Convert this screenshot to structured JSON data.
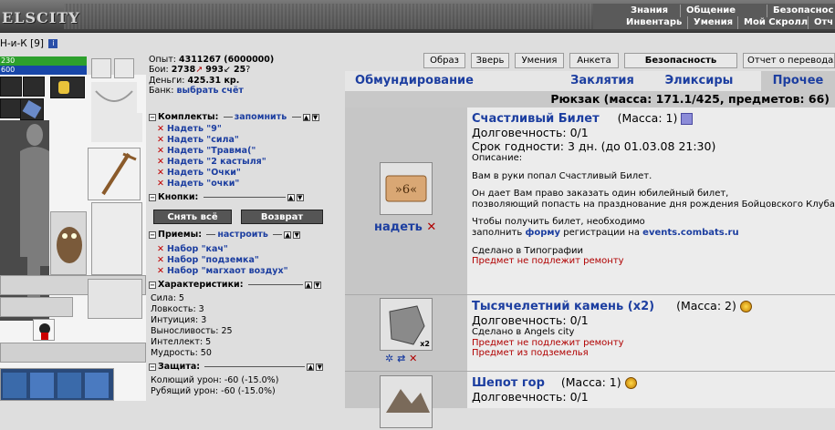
{
  "header": {
    "logo": "ELSCITY",
    "menu_row1": [
      "Знания",
      "Общение",
      "Безопаснос"
    ],
    "menu_row2": [
      "Инвентарь",
      "Умения",
      "Мой Скролл",
      "Отч"
    ]
  },
  "character": {
    "nick": "Н-и-К",
    "level": "[9]",
    "hp": "230",
    "mp": "600"
  },
  "stats": {
    "exp_label": "Опыт:",
    "exp": "4311267",
    "exp_next": "(6000000)",
    "fights_label": "Бои:",
    "wins": "2738",
    "losses": "993",
    "draws": "25",
    "money_label": "Деньги:",
    "money": "425.31 кр.",
    "bank_label": "Банк:",
    "bank_link": "выбрать счёт"
  },
  "komplekty": {
    "title": "Комплекты:",
    "link": "запомнить",
    "items": [
      "Надеть \"9\"",
      "Надеть \"сила\"",
      "Надеть \"Травма(\"",
      "Надеть \"2 кастыля\"",
      "Надеть \"Очки\"",
      "Надеть \"очки\""
    ]
  },
  "knopki": {
    "title": "Кнопки:",
    "btn_remove": "Снять всё",
    "btn_return": "Возврат"
  },
  "priemy": {
    "title": "Приемы:",
    "link": "настроить",
    "items": [
      "Набор \"кач\"",
      "Набор \"подземка\"",
      "Набор \"магхаот воздух\""
    ]
  },
  "characteristics": {
    "title": "Характеристики:",
    "rows": [
      "Сила: 5",
      "Ловкость: 3",
      "Интуиция: 3",
      "Выносливость: 25",
      "Интеллект: 5",
      "Мудрость: 50"
    ]
  },
  "zashchita": {
    "title": "Защита:",
    "rows": [
      "Колющий урон: -60 (-15.0%)",
      "Рубящий урон: -60 (-15.0%)"
    ]
  },
  "nav_buttons": [
    "Образ",
    "Зверь",
    "Умения",
    "Анкета",
    "Безопасность",
    "Отчет о переводах"
  ],
  "tabs": [
    "Обмундирование",
    "Заклятия",
    "Эликсиры",
    "Прочее"
  ],
  "backpack": "Рюкзак (масса: 171.1/425, предметов: 66)",
  "items": [
    {
      "name": "Счастливый Билет",
      "mass": "(Масса: 1)",
      "durability": "Долговечность: 0/1",
      "expiry": "Срок годности: 3 дн. (до 01.03.08 21:30)",
      "desc_label": "Описание:",
      "desc1": "Вам в руки попал Счастливый Билет.",
      "desc2": "Он дает Вам право заказать один юбилейный билет,",
      "desc3": "позволяющий попасть на празднование дня рождения Бойцовского Клуба",
      "desc4": "Чтобы получить билет, необходимо",
      "desc5_pre": "заполнить ",
      "desc5_link": "форму",
      "desc5_mid": " регистрации на ",
      "desc5_site": "events.combats.ru",
      "made": "Сделано в Типографии",
      "norepair": "Предмет не подлежит ремонту",
      "action": "надеть"
    },
    {
      "name": "Тысячелетний камень (x2)",
      "mass": "(Масса: 2)",
      "durability": "Долговечность: 0/1",
      "made": "Сделано в Angels city",
      "norepair": "Предмет не подлежит ремонту",
      "origin": "Предмет из подземелья",
      "count": "x2"
    },
    {
      "name": "Шепот гор",
      "mass": "(Масса: 1)",
      "durability": "Долговечность: 0/1"
    }
  ],
  "colors": {
    "link": "#1c3ea0",
    "warn": "#b00000",
    "hp": "#2da02d",
    "mp": "#1846a8"
  }
}
